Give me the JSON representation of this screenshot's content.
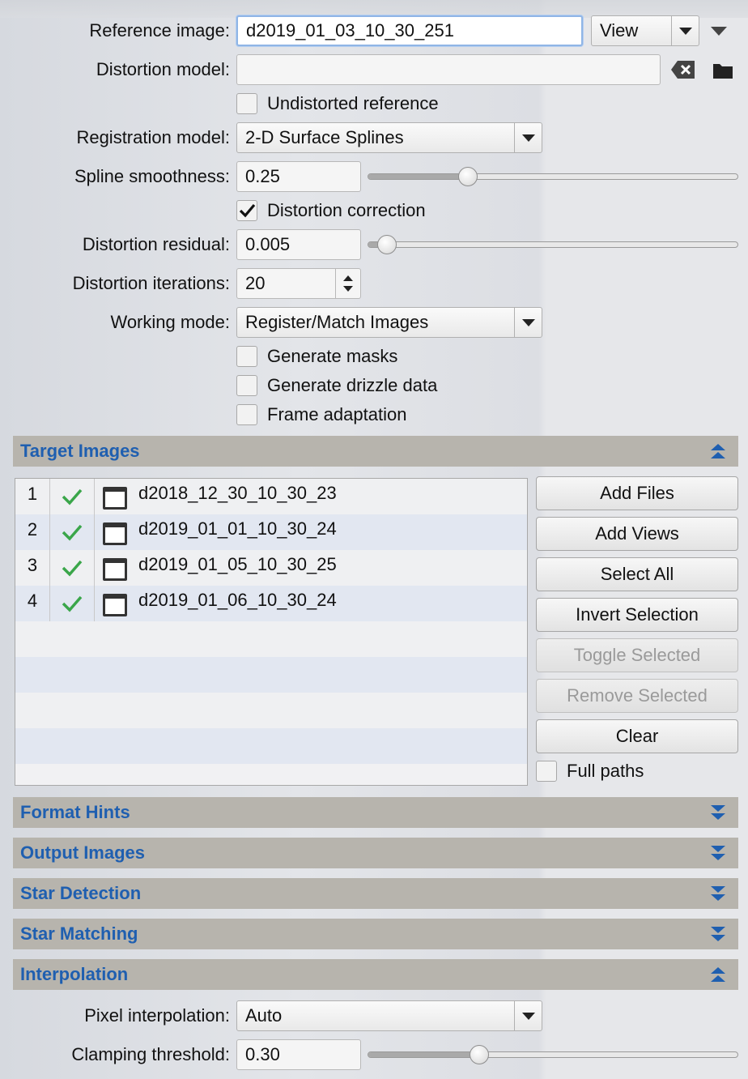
{
  "form": {
    "reference_image": {
      "label": "Reference image:",
      "value": "d2019_01_03_10_30_251",
      "button": "View"
    },
    "distortion_model": {
      "label": "Distortion model:",
      "value": ""
    },
    "undistorted_reference": {
      "label": "Undistorted reference",
      "checked": false
    },
    "registration_model": {
      "label": "Registration model:",
      "value": "2-D Surface Splines"
    },
    "spline_smoothness": {
      "label": "Spline smoothness:",
      "value": "0.25",
      "slider_fraction": 0.27
    },
    "distortion_correction": {
      "label": "Distortion correction",
      "checked": true
    },
    "distortion_residual": {
      "label": "Distortion residual:",
      "value": "0.005",
      "slider_fraction": 0.05
    },
    "distortion_iterations": {
      "label": "Distortion iterations:",
      "value": "20"
    },
    "working_mode": {
      "label": "Working mode:",
      "value": "Register/Match Images"
    },
    "generate_masks": {
      "label": "Generate masks",
      "checked": false
    },
    "generate_drizzle": {
      "label": "Generate drizzle data",
      "checked": false
    },
    "frame_adaptation": {
      "label": "Frame adaptation",
      "checked": false
    }
  },
  "sections": {
    "target_images": "Target Images",
    "format_hints": "Format Hints",
    "output_images": "Output Images",
    "star_detection": "Star Detection",
    "star_matching": "Star Matching",
    "interpolation": "Interpolation"
  },
  "target_images": [
    {
      "index": "1",
      "name": "d2018_12_30_10_30_23"
    },
    {
      "index": "2",
      "name": "d2019_01_01_10_30_24"
    },
    {
      "index": "3",
      "name": "d2019_01_05_10_30_25"
    },
    {
      "index": "4",
      "name": "d2019_01_06_10_30_24"
    }
  ],
  "buttons": {
    "add_files": "Add Files",
    "add_views": "Add Views",
    "select_all": "Select All",
    "invert_selection": "Invert Selection",
    "toggle_selected": "Toggle Selected",
    "remove_selected": "Remove Selected",
    "clear": "Clear",
    "full_paths": "Full paths"
  },
  "interpolation": {
    "pixel_interpolation": {
      "label": "Pixel interpolation:",
      "value": "Auto"
    },
    "clamping_threshold": {
      "label": "Clamping threshold:",
      "value": "0.30",
      "slider_fraction": 0.3
    }
  },
  "colors": {
    "section_title": "#1f5fb0",
    "section_bg": "#b7b4ad",
    "check_green": "#3aa64a"
  }
}
